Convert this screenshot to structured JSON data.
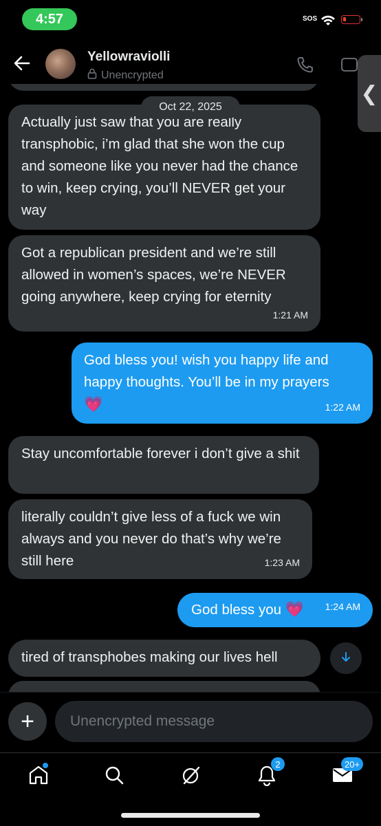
{
  "status_bar": {
    "time": "4:57",
    "sos": "SOS"
  },
  "header": {
    "contact_name": "Yellowraviolli",
    "encryption": "Unencrypted"
  },
  "thread": {
    "date": "Oct 22, 2025",
    "messages": [
      {
        "side": "in",
        "text": "Actually just saw that you are really transphobic, i’m glad that she won the cup and someone like you never had the chance to win, keep crying, you’ll NEVER get your way",
        "time": ""
      },
      {
        "side": "in",
        "text": "Got a republican president and we’re still allowed in women’s spaces, we’re NEVER going anywhere, keep crying for eternity",
        "time": "1:21 AM"
      },
      {
        "side": "out",
        "text": "God bless you! wish you happy life and happy thoughts. You’ll be in my prayers",
        "emoji": "💗",
        "time": "1:22 AM"
      },
      {
        "side": "in",
        "text": "Stay uncomfortable forever i don’t give a shit",
        "time": ""
      },
      {
        "side": "in",
        "text": "literally couldn’t give less of a fuck we win always and you never do that’s why we’re still here",
        "time": "1:23 AM"
      },
      {
        "side": "out",
        "text": "God bless you",
        "emoji": "💗",
        "time": "1:24 AM"
      },
      {
        "side": "in",
        "text": "tired of transphobes making our lives hell",
        "time": ""
      }
    ]
  },
  "composer": {
    "placeholder": "Unencrypted message"
  },
  "nav": {
    "notifications_badge": "2",
    "messages_badge": "20+"
  },
  "colors": {
    "accent": "#1d9bf0",
    "incoming_bubble": "#2f3336",
    "background": "#000000"
  }
}
